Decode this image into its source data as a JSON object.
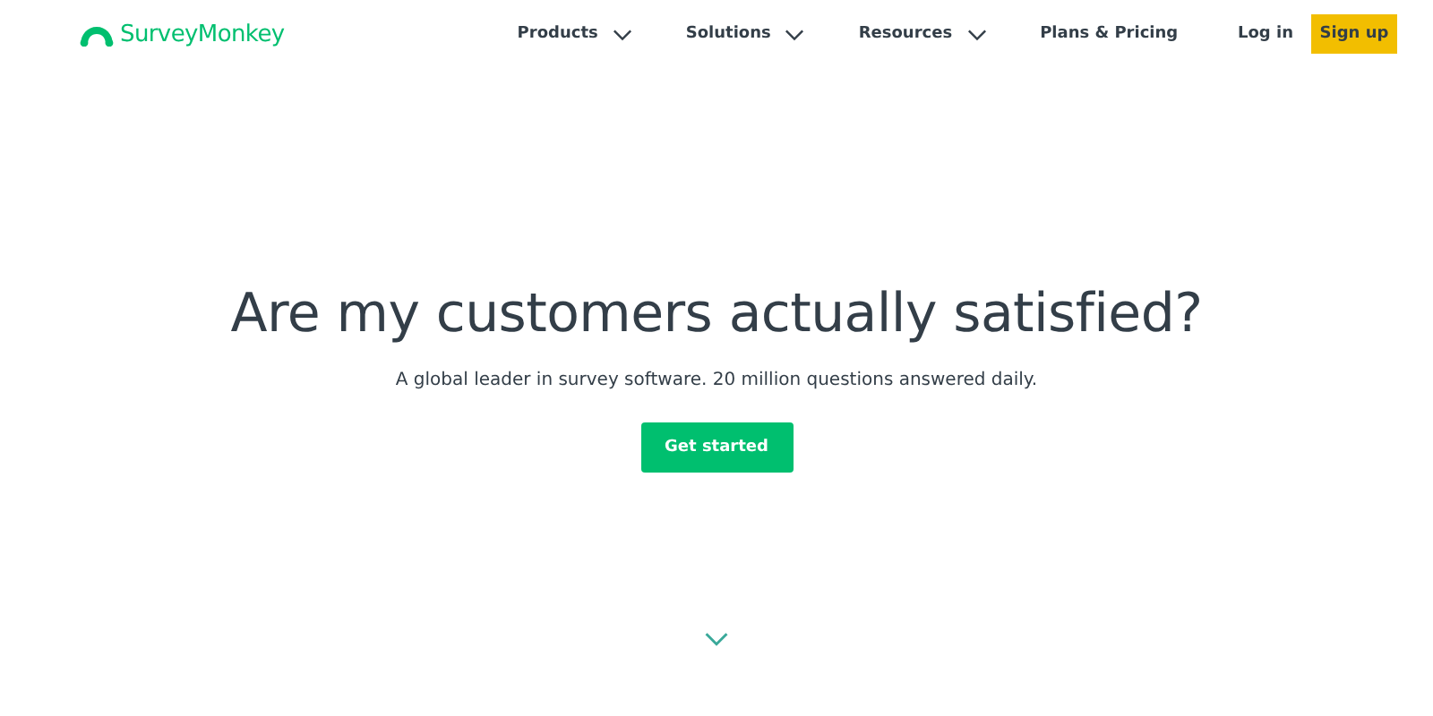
{
  "header": {
    "logo": "SurveyMonkey",
    "nav": [
      {
        "label": "Products",
        "kind": "dropdown"
      },
      {
        "label": "Solutions",
        "kind": "dropdown"
      },
      {
        "label": "Resources",
        "kind": "dropdown"
      },
      {
        "label": "Plans & Pricing",
        "kind": "link"
      }
    ],
    "login": "Log in",
    "signup": "Sign up"
  },
  "hero": {
    "heading": "Are my customers actually satisfied?",
    "subtitle": "A global leader in survey software. 20 million questions answered daily.",
    "cta": "Get started"
  }
}
